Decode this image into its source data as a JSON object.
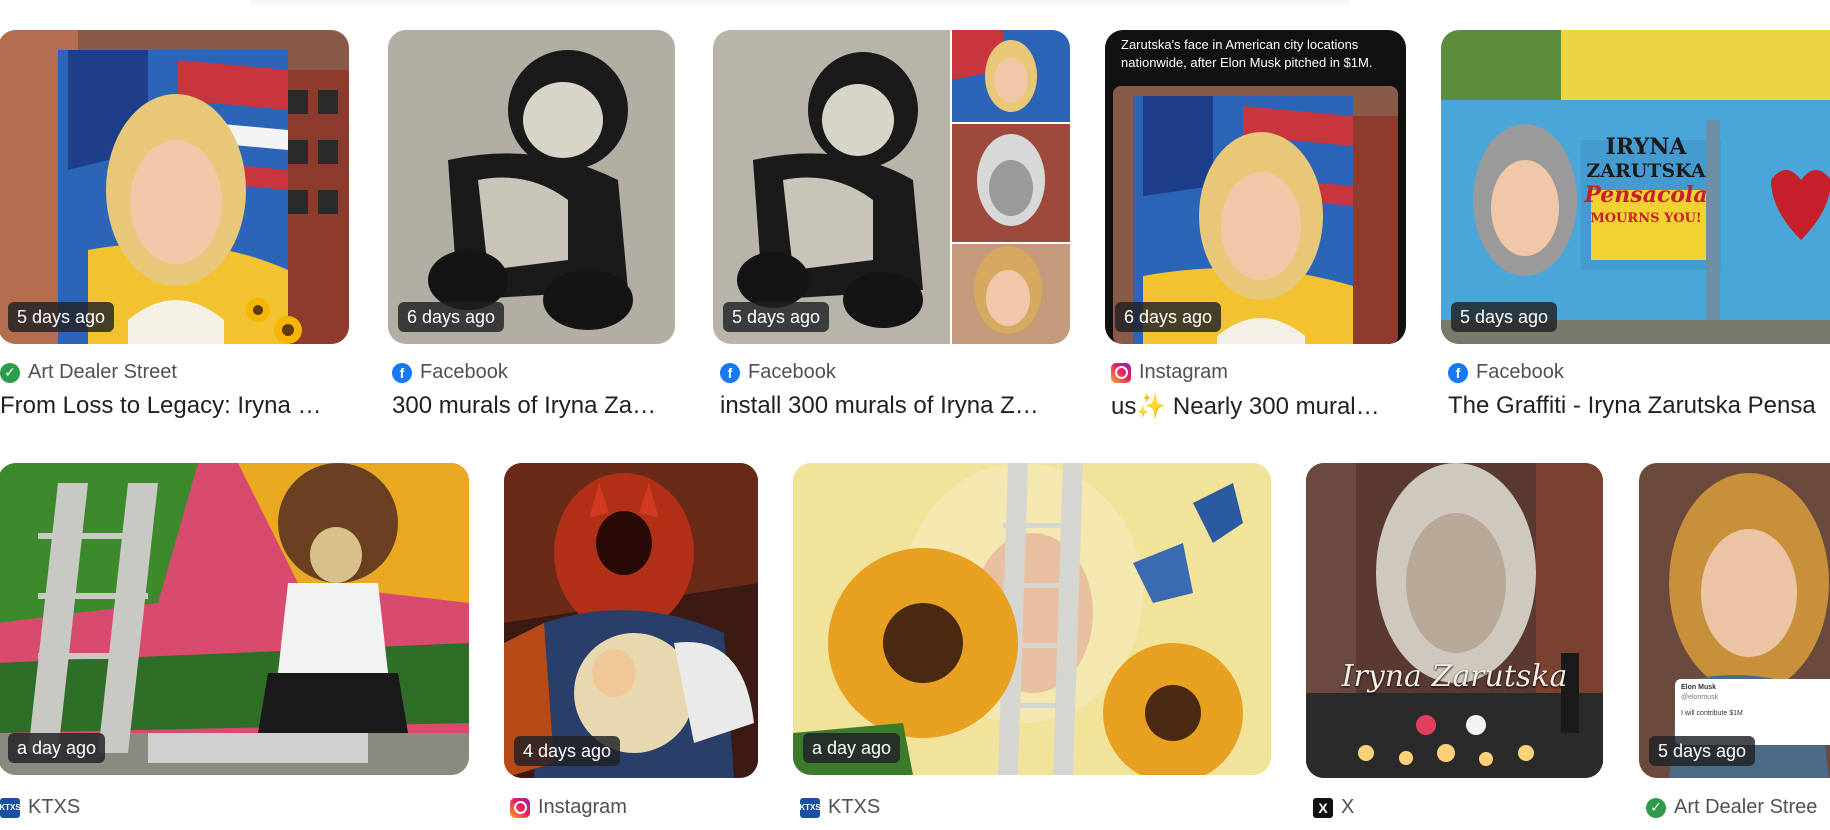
{
  "results": [
    {
      "time": "5 days ago",
      "source": "Art Dealer Street",
      "source_icon": "art-dealer-street-icon",
      "title": "From Loss to Legacy: Iryna …"
    },
    {
      "time": "6 days ago",
      "source": "Facebook",
      "source_icon": "facebook-icon",
      "title": "300 murals of Iryna Za…"
    },
    {
      "time": "5 days ago",
      "source": "Facebook",
      "source_icon": "facebook-icon",
      "title": "install 300 murals of Iryna Z…"
    },
    {
      "time": "6 days ago",
      "source": "Instagram",
      "source_icon": "instagram-icon",
      "title": "us✨ Nearly 300 mural…",
      "image_caption": "Zarutska's face in American city locations nationwide, after Elon Musk pitched in $1M."
    },
    {
      "time": "5 days ago",
      "source": "Facebook",
      "source_icon": "facebook-icon",
      "title": "The Graffiti - Iryna Zarutska Pensa",
      "mural_text": [
        "IRYNA",
        "ZARUTSKA",
        "Pensacola",
        "MOURNS YOU!"
      ]
    },
    {
      "time": "a day ago",
      "source": "KTXS",
      "source_icon": "ktxs-icon"
    },
    {
      "time": "4 days ago",
      "source": "Instagram",
      "source_icon": "instagram-icon"
    },
    {
      "time": "a day ago",
      "source": "KTXS",
      "source_icon": "ktxs-icon"
    },
    {
      "time": "",
      "source": "X",
      "source_icon": "x-icon",
      "mural_text": "Iryna Zarutska"
    },
    {
      "time": "5 days ago",
      "source": "Art Dealer Stree",
      "source_icon": "art-dealer-street-icon",
      "image_caption": [
        "Elon Musk",
        "@elonmusk",
        "I will contribute $1M"
      ]
    }
  ],
  "icons": {
    "ktxs": "KTXS",
    "x": "X"
  },
  "colors": {
    "facebook": "#1877f2",
    "art_dealer": "#2e9b4f",
    "ktxs": "#1b4fa0",
    "badge_bg": "#202124"
  }
}
